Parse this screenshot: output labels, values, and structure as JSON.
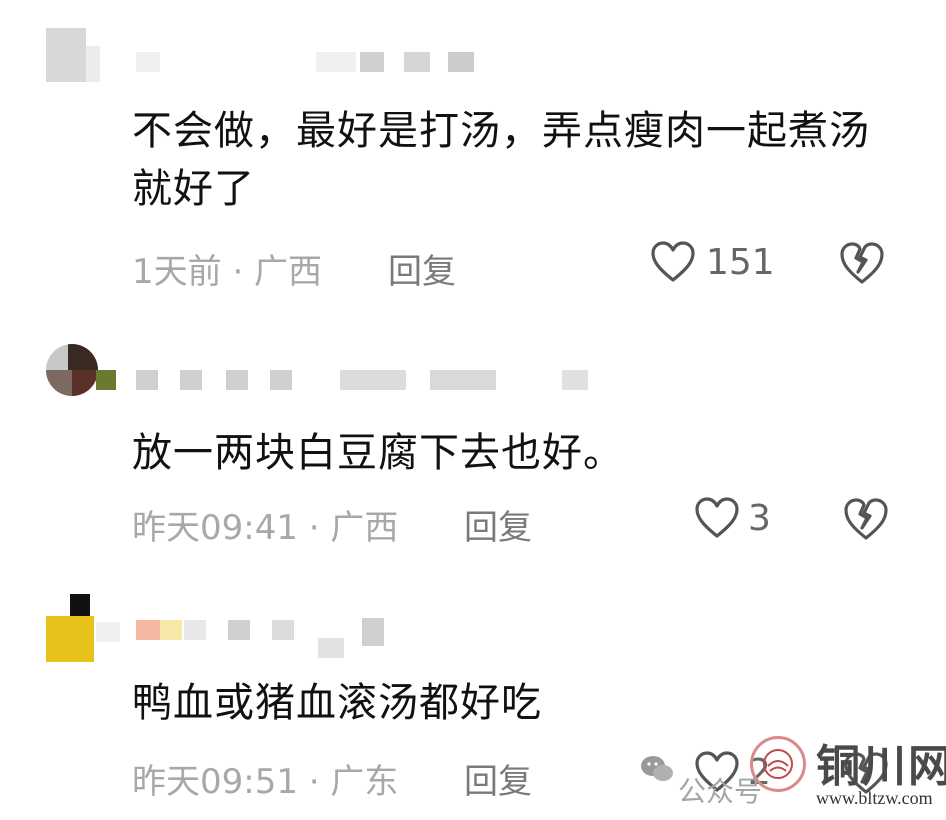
{
  "comments": [
    {
      "text": "不会做，最好是打汤，弄点瘦肉一起煮汤就好了",
      "time_location": "1天前 · 广西",
      "reply_label": "回复",
      "likes": "151"
    },
    {
      "text": "放一两块白豆腐下去也好。",
      "time_location": "昨天09:41 · 广西",
      "reply_label": "回复",
      "likes": "3"
    },
    {
      "text": "鸭血或猪血滚汤都好吃",
      "time_location": "昨天09:51 · 广东",
      "reply_label": "回复",
      "likes": "2"
    }
  ],
  "watermark": {
    "wechat_icon": "wechat-icon",
    "account_text": "公众号",
    "brand": "铜川网",
    "url": "www.bltzw.com"
  },
  "icons": {
    "like": "heart-outline-icon",
    "dislike": "broken-heart-icon"
  }
}
